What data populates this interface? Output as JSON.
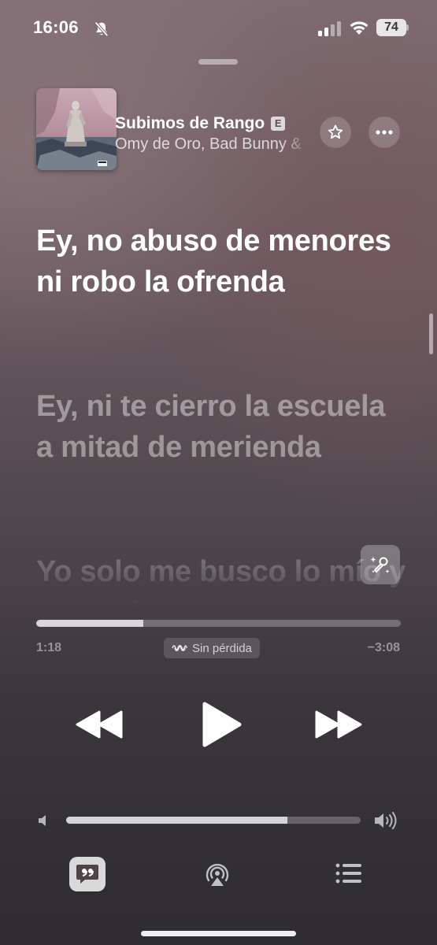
{
  "status_bar": {
    "time": "16:06",
    "battery": "74",
    "icons": [
      "bell-slash-icon",
      "signal-icon",
      "wifi-icon",
      "battery-icon"
    ]
  },
  "now_playing": {
    "title": "Subimos de Rango",
    "explicit_badge": "E",
    "artist": "Omy de Oro, Bad Bunny &",
    "icons": [
      "star-icon",
      "ellipsis-icon"
    ]
  },
  "lyrics": {
    "current": "Ey, no abuso de menores ni robo la ofrenda",
    "next": "Ey, ni te cierro la escuela a mitad de merienda",
    "upcoming": "Yo solo me busco lo mío y no suelto"
  },
  "progress": {
    "elapsed": "1:18",
    "remaining": "−3:08",
    "fraction": 0.293,
    "quality_label": "Sin pérdida"
  },
  "volume": {
    "level": 0.75
  },
  "toolbar": {
    "icons": [
      "lyrics-quote-icon",
      "airplay-icon",
      "queue-list-icon"
    ]
  },
  "colors": {
    "primary_text": "#ffffff",
    "secondary_text": "rgba(255,255,255,0.45)"
  }
}
